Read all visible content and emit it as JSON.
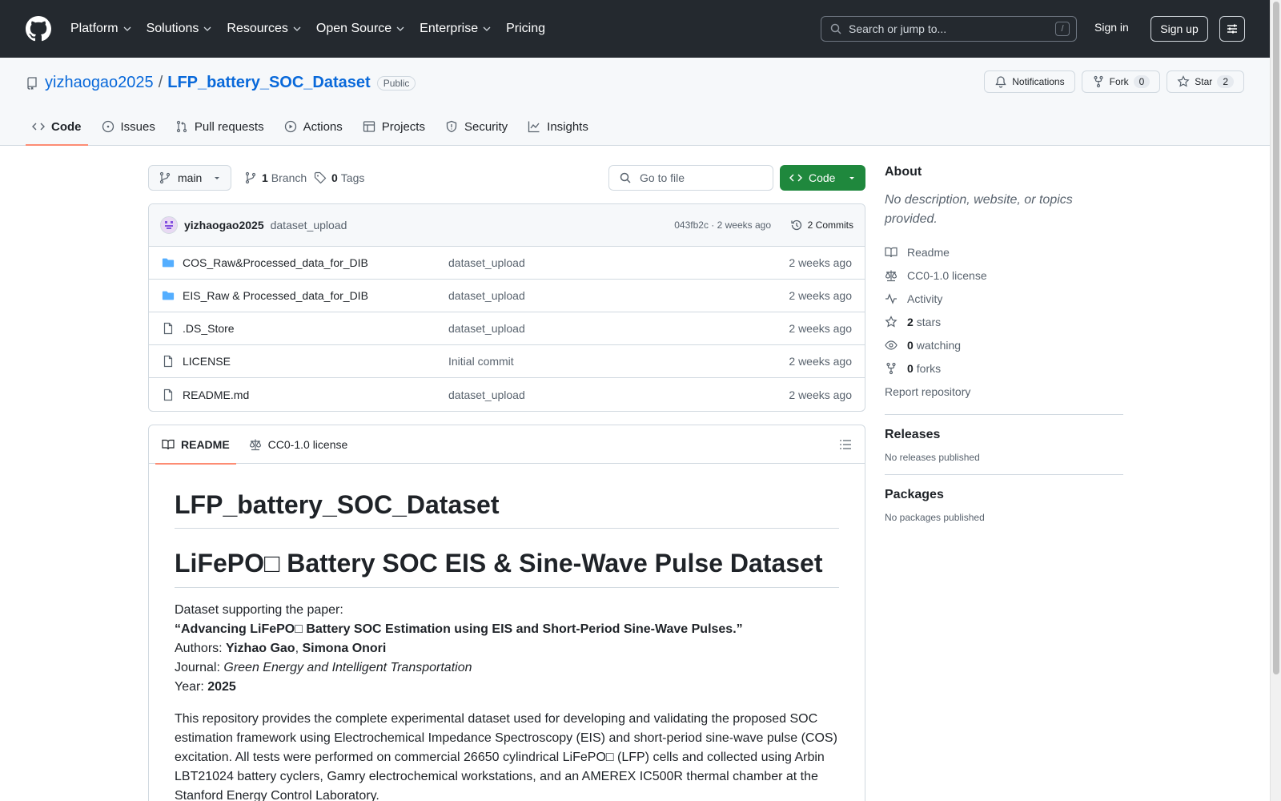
{
  "header": {
    "nav": [
      {
        "label": "Platform"
      },
      {
        "label": "Solutions"
      },
      {
        "label": "Resources"
      },
      {
        "label": "Open Source"
      },
      {
        "label": "Enterprise"
      },
      {
        "label": "Pricing"
      }
    ],
    "search_placeholder": "Search or jump to...",
    "search_shortcut": "/",
    "signin": "Sign in",
    "signup": "Sign up"
  },
  "repo": {
    "owner": "yizhaogao2025",
    "separator": "/",
    "name": "LFP_battery_SOC_Dataset",
    "visibility": "Public",
    "notifications_label": "Notifications",
    "fork_label": "Fork",
    "fork_count": "0",
    "star_label": "Star",
    "star_count": "2",
    "tabs": [
      {
        "label": "Code",
        "icon": "code-icon",
        "active": true
      },
      {
        "label": "Issues",
        "icon": "issue-icon"
      },
      {
        "label": "Pull requests",
        "icon": "pull-request-icon"
      },
      {
        "label": "Actions",
        "icon": "play-icon"
      },
      {
        "label": "Projects",
        "icon": "table-icon"
      },
      {
        "label": "Security",
        "icon": "shield-icon"
      },
      {
        "label": "Insights",
        "icon": "graph-icon"
      }
    ]
  },
  "toolbar": {
    "branch": "main",
    "branch_count": "1",
    "branch_label": "Branch",
    "tag_count": "0",
    "tag_label": "Tags",
    "goto_placeholder": "Go to file",
    "code_label": "Code"
  },
  "commit": {
    "author": "yizhaogao2025",
    "message": "dataset_upload",
    "hash_time": "043fb2c · 2 weeks ago",
    "commits_label": "2 Commits"
  },
  "files": [
    {
      "type": "folder",
      "name": "COS_Raw&Processed_data_for_DIB",
      "message": "dataset_upload",
      "date": "2 weeks ago"
    },
    {
      "type": "folder",
      "name": "EIS_Raw & Processed_data_for_DIB",
      "message": "dataset_upload",
      "date": "2 weeks ago"
    },
    {
      "type": "file",
      "name": ".DS_Store",
      "message": "dataset_upload",
      "date": "2 weeks ago"
    },
    {
      "type": "file",
      "name": "LICENSE",
      "message": "Initial commit",
      "date": "2 weeks ago"
    },
    {
      "type": "file",
      "name": "README.md",
      "message": "dataset_upload",
      "date": "2 weeks ago"
    }
  ],
  "readme": {
    "tab_readme": "README",
    "tab_license": "CC0-1.0 license",
    "title": "LFP_battery_SOC_Dataset",
    "heading": "LiFePO□ Battery SOC EIS & Sine-Wave Pulse Dataset",
    "supporting": "Dataset supporting the paper:",
    "paper_title": "“Advancing LiFePO□ Battery SOC Estimation using EIS and Short-Period Sine-Wave Pulses.”",
    "authors_label": "Authors: ",
    "author1": "Yizhao Gao",
    "author_sep": ", ",
    "author2": "Simona Onori",
    "journal_label": "Journal: ",
    "journal": "Green Energy and Intelligent Transportation",
    "year_label": "Year: ",
    "year": "2025",
    "desc_lines": [
      "This repository provides the complete experimental dataset used for developing and validating the proposed SOC",
      "estimation framework using Electrochemical Impedance Spectroscopy (EIS) and short-period sine-wave pulse (COS)",
      "excitation. All tests were performed on commercial 26650 cylindrical LiFePO□ (LFP) cells and collected using Arbin",
      "LBT21024 battery cyclers, Gamry electrochemical workstations, and an AMEREX IC500R thermal chamber at the",
      "Stanford Energy Control Laboratory."
    ]
  },
  "sidebar": {
    "about_title": "About",
    "about_desc": "No description, website, or topics provided.",
    "readme": "Readme",
    "license": "CC0-1.0 license",
    "activity": "Activity",
    "stars_count": "2",
    "stars_label": "stars",
    "watching_count": "0",
    "watching_label": "watching",
    "forks_count": "0",
    "forks_label": "forks",
    "report": "Report repository",
    "releases_title": "Releases",
    "releases_text": "No releases published",
    "packages_title": "Packages",
    "packages_text": "No packages published"
  }
}
